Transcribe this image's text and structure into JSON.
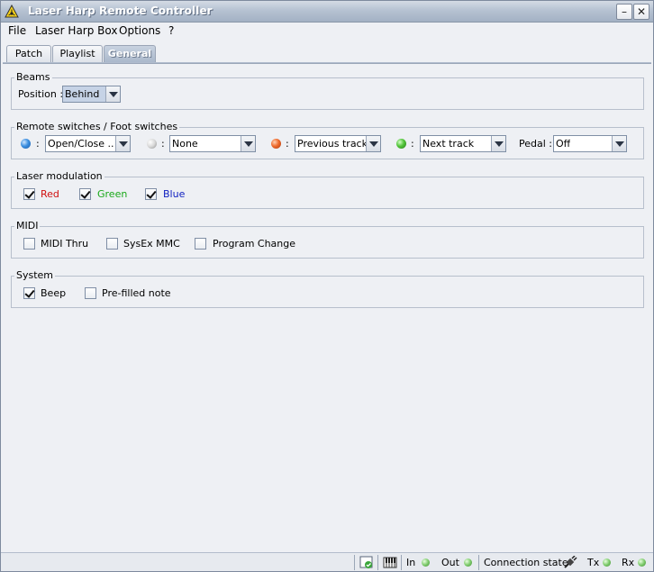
{
  "window": {
    "title": "Laser Harp Remote Controller",
    "minimize_glyph": "–",
    "close_glyph": "✕"
  },
  "menu": {
    "items": [
      "File",
      "Laser Harp Box",
      "Options",
      "?"
    ]
  },
  "tabs": {
    "items": [
      "Patch",
      "Playlist",
      "General"
    ],
    "active": "General"
  },
  "beams": {
    "legend": "Beams",
    "position_label": "Position :",
    "position_value": "Behind"
  },
  "switches": {
    "legend": "Remote switches / Foot switches",
    "colon": ":",
    "items": [
      {
        "led": "blue",
        "value": "Open/Close ..."
      },
      {
        "led": "white",
        "value": "None"
      },
      {
        "led": "orange",
        "value": "Previous track"
      },
      {
        "led": "green",
        "value": "Next track"
      }
    ],
    "pedal_label": "Pedal :",
    "pedal_value": "Off"
  },
  "modulation": {
    "legend": "Laser modulation",
    "items": [
      {
        "label": "Red",
        "checked": true,
        "color": "#d01010"
      },
      {
        "label": "Green",
        "checked": true,
        "color": "#18a818"
      },
      {
        "label": "Blue",
        "checked": true,
        "color": "#1020c0"
      }
    ]
  },
  "midi": {
    "legend": "MIDI",
    "items": [
      {
        "label": "MIDI Thru",
        "checked": false
      },
      {
        "label": "SysEx MMC",
        "checked": false
      },
      {
        "label": "Program Change",
        "checked": false
      }
    ]
  },
  "system": {
    "legend": "System",
    "items": [
      {
        "label": "Beep",
        "checked": true
      },
      {
        "label": "Pre-filled note",
        "checked": false
      }
    ]
  },
  "statusbar": {
    "in_label": "In",
    "out_label": "Out",
    "connection_label": "Connection state",
    "tx_label": "Tx",
    "rx_label": "Rx"
  },
  "colors": {
    "accent": "#a9b7ca",
    "window_bg": "#eef0f4"
  }
}
